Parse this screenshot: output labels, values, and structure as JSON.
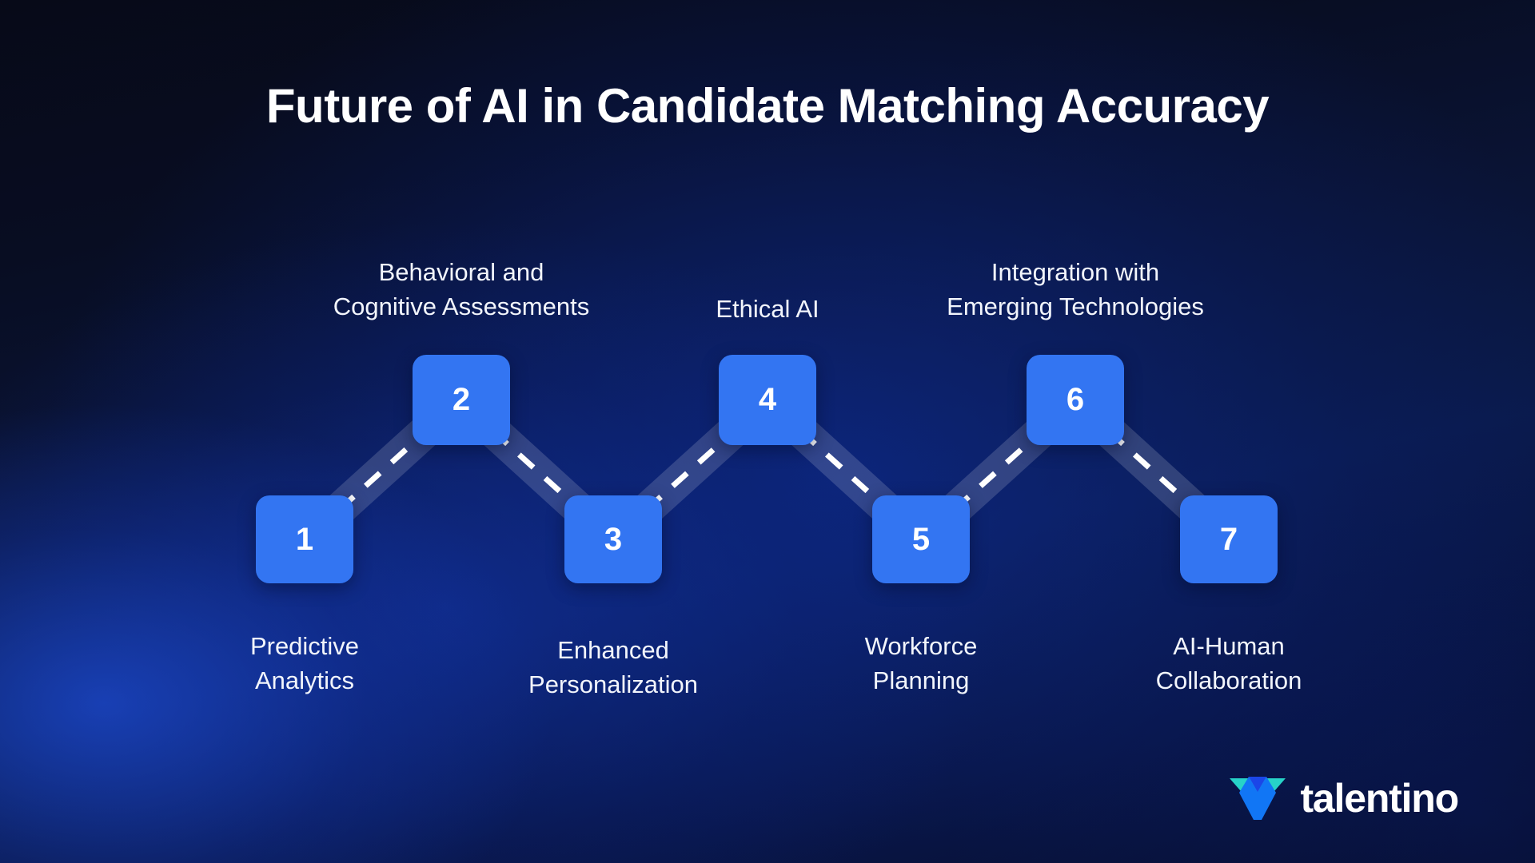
{
  "slide": {
    "title": "Future of AI in Candidate Matching Accuracy",
    "background_colors": {
      "deep_navy": "#070a18",
      "mid_blue": "#0a1a48",
      "glow_blue": "#1e4edc"
    },
    "accent_color": "#3375f2",
    "text_color": "#ffffff"
  },
  "steps": [
    {
      "number": "1",
      "label": "Predictive\nAnalytics",
      "position": "bottom"
    },
    {
      "number": "2",
      "label": "Behavioral and\nCognitive Assessments",
      "position": "top"
    },
    {
      "number": "3",
      "label": "Enhanced\nPersonalization",
      "position": "bottom"
    },
    {
      "number": "4",
      "label": "Ethical AI",
      "position": "top"
    },
    {
      "number": "5",
      "label": "Workforce\nPlanning",
      "position": "bottom"
    },
    {
      "number": "6",
      "label": "Integration with\nEmerging Technologies",
      "position": "top"
    },
    {
      "number": "7",
      "label": "AI-Human\nCollaboration",
      "position": "bottom"
    }
  ],
  "brand": {
    "name": "talentino",
    "logo_icon": "talentino-v-mark",
    "mark_colors": {
      "teal": "#27d3c8",
      "blue": "#1176f5",
      "deep_blue": "#1b46e8"
    }
  }
}
